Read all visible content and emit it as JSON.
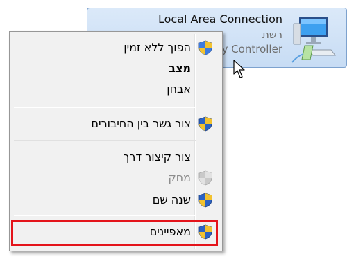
{
  "connection": {
    "name": "Local Area Connection",
    "network": "רשת",
    "device": "y Controller"
  },
  "menu": {
    "items": [
      {
        "label": "הפוך ללא זמין",
        "icon": "uac-shield-icon",
        "bold": false,
        "enabled": true
      },
      {
        "label": "מצב",
        "icon": "",
        "bold": true,
        "enabled": true
      },
      {
        "label": "אבחן",
        "icon": "",
        "bold": false,
        "enabled": true
      },
      {
        "label": "צור גשר בין החיבורים",
        "icon": "uac-shield-icon",
        "bold": false,
        "enabled": true
      },
      {
        "label": "צור קיצור דרך",
        "icon": "",
        "bold": false,
        "enabled": true
      },
      {
        "label": "מחק",
        "icon": "uac-shield-icon",
        "bold": false,
        "enabled": false
      },
      {
        "label": "שנה שם",
        "icon": "uac-shield-icon",
        "bold": false,
        "enabled": true
      },
      {
        "label": "מאפיינים",
        "icon": "uac-shield-icon",
        "bold": false,
        "enabled": true
      }
    ]
  },
  "colors": {
    "highlight": "#e4141b",
    "tile_bg": "#c7dcf4",
    "menu_bg": "#f1f1f1"
  }
}
